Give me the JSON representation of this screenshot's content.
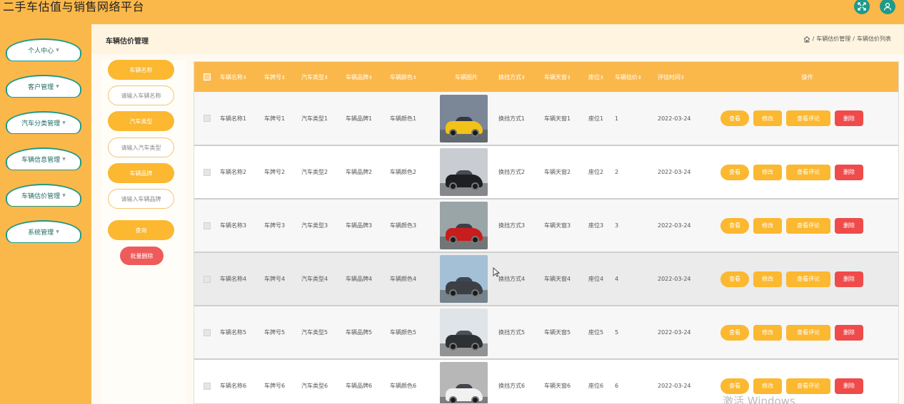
{
  "app": {
    "title": "二手车估值与销售网络平台"
  },
  "header_icons": [
    {
      "name": "fullscreen-icon"
    },
    {
      "name": "user-icon"
    }
  ],
  "sidebar": {
    "items": [
      {
        "label": "个人中心"
      },
      {
        "label": "客户管理"
      },
      {
        "label": "汽车分类管理"
      },
      {
        "label": "车辆信息管理"
      },
      {
        "label": "车辆估价管理"
      },
      {
        "label": "系统管理"
      }
    ]
  },
  "page": {
    "title": "车辆估价管理",
    "breadcrumb": [
      "车辆估价管理",
      "车辆估价列表"
    ],
    "breadcrumb_sep": "/"
  },
  "search": {
    "fields": [
      {
        "label": "车辆名称",
        "placeholder": "请输入车辆名称"
      },
      {
        "label": "汽车类型",
        "placeholder": "请输入汽车类型"
      },
      {
        "label": "车辆品牌",
        "placeholder": "请输入车辆品牌"
      }
    ],
    "search_button": "查询",
    "batch_delete_button": "批量删除"
  },
  "table": {
    "columns": [
      "车辆名称",
      "车牌号",
      "汽车类型",
      "车辆品牌",
      "车辆颜色",
      "车辆图片",
      "换挡方式",
      "车辆天窗",
      "座位",
      "车辆估价",
      "评估时间",
      "操作"
    ],
    "sort_mark": "⇕",
    "actions": {
      "view": "查看",
      "edit": "修改",
      "review": "查看评论",
      "delete": "删除"
    },
    "rows": [
      {
        "name": "车辆名称1",
        "plate": "车牌号1",
        "type": "汽车类型1",
        "brand": "车辆品牌1",
        "color": "车辆颜色1",
        "gear": "换挡方式1",
        "sunroof": "车辆天窗1",
        "seat": "座位1",
        "price": "1",
        "date": "2022-03-24",
        "car_color": "#f2c219",
        "bg": "#7b8797"
      },
      {
        "name": "车辆名称2",
        "plate": "车牌号2",
        "type": "汽车类型2",
        "brand": "车辆品牌2",
        "color": "车辆颜色2",
        "gear": "换挡方式2",
        "sunroof": "车辆天窗2",
        "seat": "座位2",
        "price": "2",
        "date": "2022-03-24",
        "car_color": "#1d1f23",
        "bg": "#c9cdd2"
      },
      {
        "name": "车辆名称3",
        "plate": "车牌号3",
        "type": "汽车类型3",
        "brand": "车辆品牌3",
        "color": "车辆颜色3",
        "gear": "换挡方式3",
        "sunroof": "车辆天窗3",
        "seat": "座位3",
        "price": "3",
        "date": "2022-03-24",
        "car_color": "#c81d1d",
        "bg": "#9aa5a8"
      },
      {
        "name": "车辆名称4",
        "plate": "车牌号4",
        "type": "汽车类型4",
        "brand": "车辆品牌4",
        "color": "车辆颜色4",
        "gear": "换挡方式4",
        "sunroof": "车辆天窗4",
        "seat": "座位4",
        "price": "4",
        "date": "2022-03-24",
        "car_color": "#3c3f44",
        "bg": "#a4c0d6"
      },
      {
        "name": "车辆名称5",
        "plate": "车牌号5",
        "type": "汽车类型5",
        "brand": "车辆品牌5",
        "color": "车辆颜色5",
        "gear": "换挡方式5",
        "sunroof": "车辆天窗5",
        "seat": "座位5",
        "price": "5",
        "date": "2022-03-24",
        "car_color": "#2d3136",
        "bg": "#dfe4e8"
      },
      {
        "name": "车辆名称6",
        "plate": "车牌号6",
        "type": "汽车类型6",
        "brand": "车辆品牌6",
        "color": "车辆颜色6",
        "gear": "换挡方式6",
        "sunroof": "车辆天窗6",
        "seat": "座位6",
        "price": "6",
        "date": "2022-03-24",
        "car_color": "#f1f1f1",
        "bg": "#b7b7b7"
      }
    ]
  },
  "watermark": "激活 Windows",
  "colors": {
    "primary": "#fbb84a",
    "accent_teal": "#1e9a8a",
    "danger": "#ef4b4b"
  }
}
